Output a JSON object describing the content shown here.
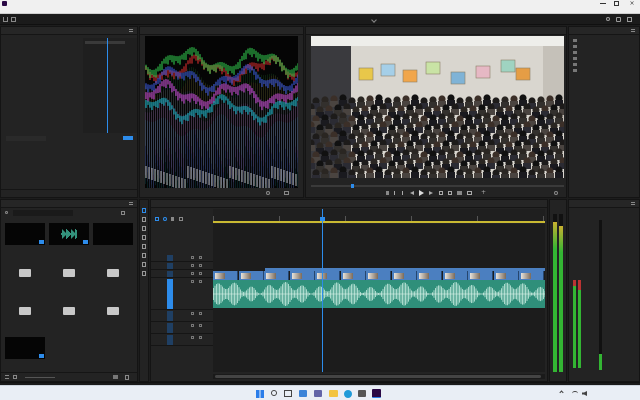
{
  "window": {
    "title": ""
  },
  "menu": {
    "items": [
      "",
      "",
      "",
      "",
      "",
      "",
      "",
      ""
    ]
  },
  "workspaces": {
    "items": [
      "",
      "",
      "",
      "",
      "",
      "",
      ""
    ],
    "active_index": 2
  },
  "effect_controls": {
    "tabs": [
      "",
      "",
      ""
    ],
    "active_tab": 2,
    "source_clip": "",
    "properties": [
      "",
      "",
      "",
      "",
      "",
      "",
      "",
      "",
      "",
      "",
      "",
      "",
      ""
    ],
    "values": [
      "",
      "",
      "",
      "",
      "",
      "",
      "",
      "",
      "",
      "",
      "",
      "",
      ""
    ],
    "audio_clip": "",
    "audio_rows": [
      "",
      "",
      "",
      "",
      "",
      "",
      ""
    ],
    "lower_rows": [
      "",
      "",
      ""
    ],
    "timecode": ""
  },
  "scopes": {
    "label": ""
  },
  "program": {
    "label": "",
    "timecode_left": "",
    "timecode_right": "",
    "fit": "",
    "quality": ""
  },
  "project": {
    "tabs": [
      "",
      "",
      ""
    ],
    "search_placeholder": "",
    "items": [
      {
        "type": "video",
        "label": "",
        "meta": ""
      },
      {
        "type": "audio",
        "label": "",
        "meta": ""
      },
      {
        "type": "empty",
        "label": "",
        "meta": ""
      },
      {
        "type": "folder",
        "label": "",
        "meta": ""
      },
      {
        "type": "folder",
        "label": "",
        "meta": ""
      },
      {
        "type": "folder",
        "label": "",
        "meta": ""
      },
      {
        "type": "folder",
        "label": "",
        "meta": ""
      },
      {
        "type": "folder",
        "label": "",
        "meta": ""
      },
      {
        "type": "folder",
        "label": "",
        "meta": ""
      },
      {
        "type": "video",
        "label": "",
        "meta": ""
      }
    ]
  },
  "timeline": {
    "sequence_name": "",
    "timecode": "",
    "ruler_labels": [
      "",
      "",
      "",
      "",
      "",
      ""
    ],
    "video_tracks": [
      "",
      "",
      ""
    ],
    "audio_tracks": [
      "",
      "",
      "",
      ""
    ],
    "master_label": ""
  },
  "right_panel": {
    "items": [
      "",
      "",
      "",
      "",
      "",
      ""
    ]
  },
  "audio_meters": {
    "scale": [
      "",
      "",
      "",
      "",
      "",
      "",
      "",
      "",
      "",
      "",
      "",
      ""
    ]
  },
  "taskbar": {
    "clock_time": "",
    "clock_date": ""
  },
  "colors": {
    "accent_blue": "#2d8ceb",
    "video_clip": "#4b7fc0",
    "audio_clip": "#2f8f7a",
    "meter_green": "#33b533"
  }
}
